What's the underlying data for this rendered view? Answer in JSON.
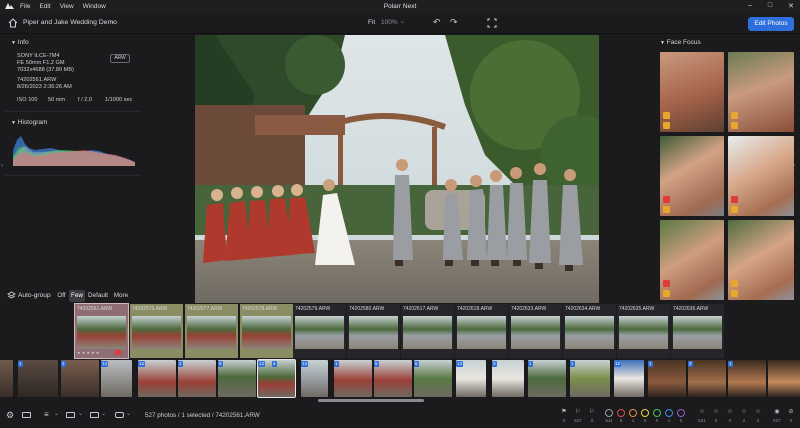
{
  "window": {
    "title": "Polarr Next",
    "menu": [
      "File",
      "Edit",
      "View",
      "Window"
    ]
  },
  "toolbar": {
    "album": "Piper and Jake Wedding Demo",
    "fit_label": "Fit",
    "zoom": "100%",
    "edit_button": "Edit Photos"
  },
  "info": {
    "heading": "Info",
    "camera": "SONY ILCE-7M4",
    "lens": "FE 50mm F1.2 GM",
    "dims": "7032x4688 (37.80 MB)",
    "filename": "74202561.ARW",
    "datetime": "8/26/2023 2:36:26 AM",
    "format_badge": "ARW",
    "iso": "ISO 100",
    "focal": "50 mm",
    "aperture": "f / 2.0",
    "shutter": "1/1000 sec"
  },
  "histogram": {
    "heading": "Histogram"
  },
  "face_focus": {
    "heading": "Face Focus"
  },
  "autogroup": {
    "label": "Auto-group",
    "options": [
      "Off",
      "Few",
      "Default",
      "More"
    ],
    "selected": "Few"
  },
  "strip1": [
    "74202561.ARW",
    "74202576.ARW",
    "74202577.ARW",
    "74202578.ARW",
    "74202579.ARW",
    "74202580.ARW",
    "74202617.ARW",
    "74202618.ARW",
    "74202633.ARW",
    "74202634.ARW",
    "74202635.ARW",
    "74202636.ARW"
  ],
  "strip2_groups": [
    "1",
    "1",
    "14",
    "12",
    "2",
    "8",
    "12",
    "4",
    "14",
    "1",
    "5",
    "6",
    "13",
    "3",
    "1",
    "1",
    "12",
    "1",
    "2",
    "1"
  ],
  "status": "527 photos / 1 selected / 74202561.ARW",
  "filters": {
    "flag_counts": [
      "0",
      "527",
      "0"
    ],
    "color_counts": [
      "511",
      "6",
      "1",
      "0",
      "0",
      "1",
      "0"
    ],
    "star_counts": [
      "521",
      "6",
      "0",
      "2",
      "2",
      "0"
    ],
    "visible_count": "527",
    "colors": [
      "#9aa0a6",
      "#e24a4a",
      "#e8913a",
      "#e9d23a",
      "#4bbf5a",
      "#3a8ee8",
      "#9b59d0"
    ]
  }
}
